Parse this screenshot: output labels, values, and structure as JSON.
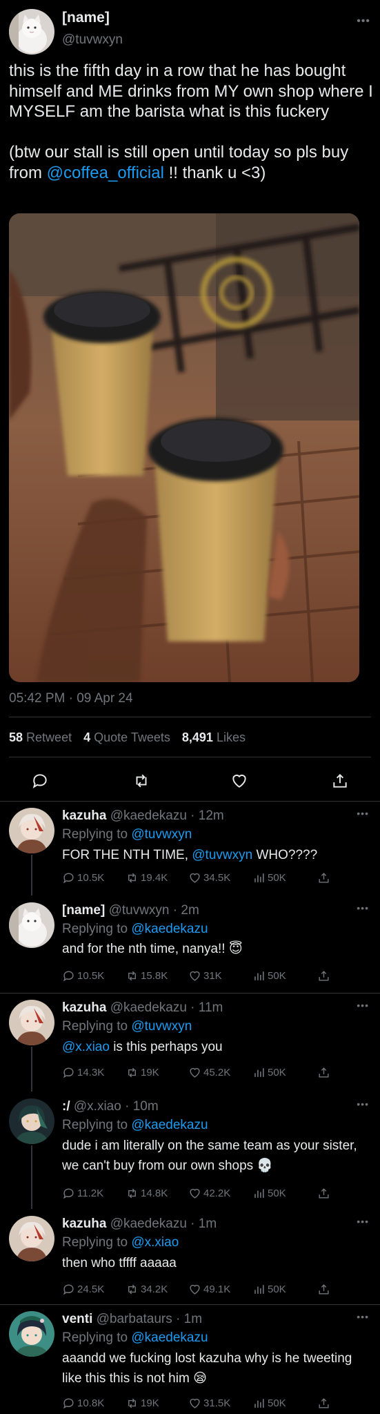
{
  "main_tweet": {
    "display_name": "[name]",
    "handle": "@tuvwxyn",
    "text_part1": "this is the fifth day in a row that he has bought himself and ME drinks from MY own shop where I MYSELF am the barista what is this fuckery\n\n(btw our stall is still open until today so pls buy from ",
    "text_mention": "@coffea_official",
    "text_part2": " !! thank u <3)",
    "timestamp": "05:42 PM · 09 Apr 24",
    "retweets": "58",
    "retweets_label": "Retweet",
    "quotes": "4",
    "quotes_label": "Quote Tweets",
    "likes": "8,491",
    "likes_label": "Likes"
  },
  "replies": [
    {
      "name": "kazuha",
      "handle": "@kaedekazu",
      "time": "12m",
      "replying_label": "Replying to",
      "replying_to": "@tuvwxyn",
      "text_before": "FOR THE NTH TIME, ",
      "text_mention": "@tuvwxyn",
      "text_after": " WHO????",
      "comments": "10.5K",
      "retweets": "19.4K",
      "likes": "34.5K",
      "views": "50K"
    },
    {
      "name": "[name]",
      "handle": "@tuvwxyn",
      "time": "2m",
      "replying_label": "Replying to",
      "replying_to": "@kaedekazu",
      "text_before": "and for the nth time, nanya!! 😇",
      "text_mention": "",
      "text_after": "",
      "comments": "10.5K",
      "retweets": "15.8K",
      "likes": "31K",
      "views": "50K"
    },
    {
      "name": "kazuha",
      "handle": "@kaedekazu",
      "time": "11m",
      "replying_label": "Replying to",
      "replying_to": "@tuvwxyn",
      "text_before": "",
      "text_mention": "@x.xiao",
      "text_after": " is this perhaps you",
      "comments": "14.3K",
      "retweets": "19K",
      "likes": "45.2K",
      "views": "50K"
    },
    {
      "name": ":/",
      "handle": "@x.xiao",
      "time": "10m",
      "replying_label": "Replying to",
      "replying_to": "@kaedekazu",
      "text_before": "dude i am literally on the same team as your sister, we can't buy from our own shops 💀",
      "text_mention": "",
      "text_after": "",
      "comments": "11.2K",
      "retweets": "14.8K",
      "likes": "42.2K",
      "views": "50K"
    },
    {
      "name": "kazuha",
      "handle": "@kaedekazu",
      "time": "1m",
      "replying_label": "Replying to",
      "replying_to": "@x.xiao",
      "text_before": "then who tffff aaaaa",
      "text_mention": "",
      "text_after": "",
      "comments": "24.5K",
      "retweets": "34.2K",
      "likes": "49.1K",
      "views": "50K"
    },
    {
      "name": "venti",
      "handle": "@barbataurs",
      "time": "1m",
      "replying_label": "Replying to",
      "replying_to": "@kaedekazu",
      "text_before": "aaandd we fucking lost kazuha why is he tweeting like this this is not him 😪",
      "text_mention": "",
      "text_after": "",
      "comments": "10.8K",
      "retweets": "19K",
      "likes": "31.5K",
      "views": "50K"
    }
  ],
  "separator": " · ",
  "icons": {
    "more": "more-dots-icon",
    "reply": "reply-icon",
    "retweet": "retweet-icon",
    "like": "heart-icon",
    "views": "views-icon",
    "share": "share-icon"
  },
  "colors": {
    "background": "#000000",
    "text": "#e7e9ea",
    "muted": "#71767b",
    "link": "#1d9bf0",
    "divider": "#2f3336"
  }
}
